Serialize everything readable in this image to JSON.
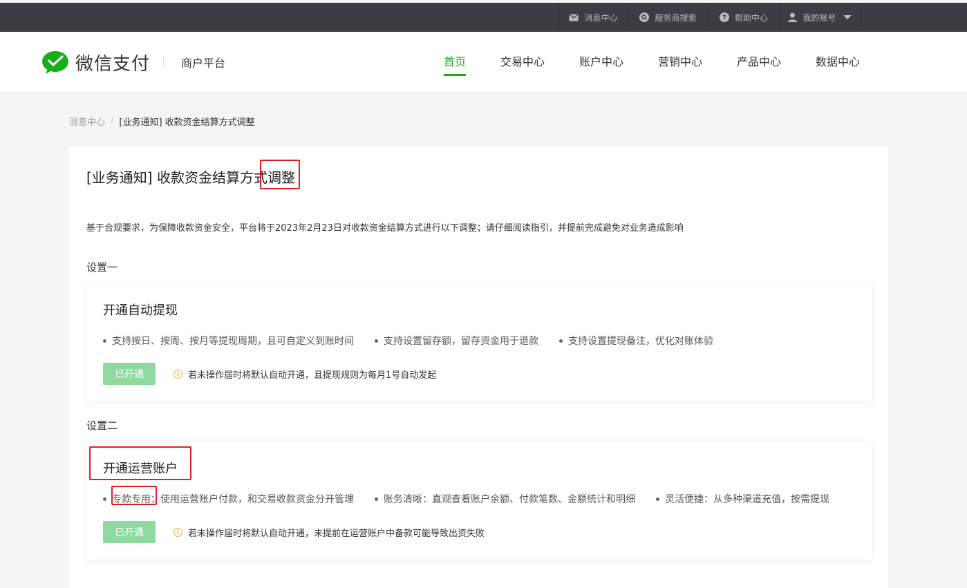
{
  "topbar": {
    "items": [
      {
        "label": "消息中心",
        "icon": "mail-icon"
      },
      {
        "label": "服务商搜索",
        "icon": "search-icon"
      },
      {
        "label": "帮助中心",
        "icon": "help-icon"
      },
      {
        "label": "我的账号",
        "icon": "user-icon"
      }
    ]
  },
  "header": {
    "logo_text": "微信支付",
    "platform": "商户平台",
    "nav": [
      "首页",
      "交易中心",
      "账户中心",
      "营销中心",
      "产品中心",
      "数据中心"
    ],
    "active_nav": "首页"
  },
  "breadcrumb": {
    "parent": "消息中心",
    "separator": "/",
    "current": "[业务通知] 收款资金结算方式调整"
  },
  "main": {
    "title": "[业务通知] 收款资金结算方式调整",
    "notice": "基于合规要求，为保障收款资金安全，平台将于2023年2月23日对收款资金结算方式进行以下调整；请仔细阅读指引，并提前完成避免对业务造成影响",
    "sections": [
      {
        "label": "设置一",
        "panel_title": "开通自动提现",
        "features": [
          "支持按日、按周、按月等提现周期，且可自定义到账时间",
          "支持设置留存额，留存资金用于退款",
          "支持设置提现备注，优化对账体验"
        ],
        "status": "已开通",
        "tip": "若未操作届时将默认自动开通，且提现规则为每月1号自动发起"
      },
      {
        "label": "设置二",
        "panel_title": "开通运营账户",
        "features": [
          "专款专用：使用运营账户付款，和交易收款资金分开管理",
          "账务清晰：直观查看账户余额、付款笔数、金额统计和明细",
          "灵活便捷：从多种渠道充值，按需提现"
        ],
        "status": "已开通",
        "tip": "若未操作届时将默认自动开通，未提前在运营账户中备款可能导致出资失败"
      }
    ]
  },
  "colors": {
    "accent": "#1aad19",
    "topbar": "#3b3d42",
    "status_button": "#8fd9a0",
    "warning": "#f0a93c",
    "highlight_box": "#e02020"
  }
}
